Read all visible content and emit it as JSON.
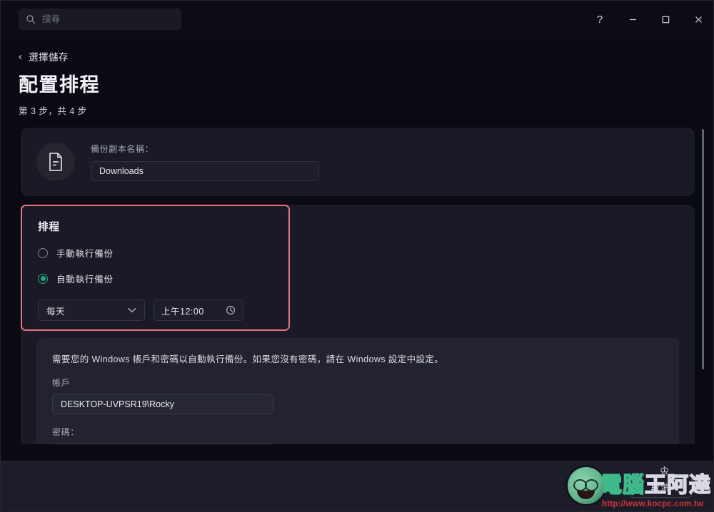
{
  "titlebar": {
    "search_placeholder": "搜尋",
    "search_value": "",
    "help_label": "?",
    "minimize_label": "–",
    "maximize_label": "□",
    "close_label": "✕"
  },
  "header": {
    "back_chevron": "‹",
    "back_label": "選擇儲存",
    "title": "配置排程",
    "step": "第 3 步，共 4 步"
  },
  "name_card": {
    "icon": "document-icon",
    "label": "備份副本名稱：",
    "value": "Downloads",
    "placeholder": "備份副本名稱"
  },
  "schedule": {
    "title": "排程",
    "options": [
      {
        "label": "手動執行備份",
        "selected": false
      },
      {
        "label": "自動執行備份",
        "selected": true
      }
    ],
    "frequency": {
      "value": "每天",
      "chevron_icon": "chevron-down-icon"
    },
    "time": {
      "value": "上午12:00",
      "clock_icon": "clock-icon"
    },
    "highlight_color": "#e4737c",
    "accent_color": "#1fa87a"
  },
  "account": {
    "note": "需要您的 Windows 帳戶和密碼以自動執行備份。如果您沒有密碼，請在 Windows 設定中設定。",
    "account_label": "帳戶",
    "account_value": "DESKTOP-UVPSR19\\Rocky",
    "account_placeholder": "帳戶",
    "password_label": "密碼：",
    "password_value": "",
    "password_placeholder": "密碼"
  },
  "footer": {
    "cancel_label": "取消"
  },
  "watermark": {
    "char1": "電",
    "char2": "腦",
    "char3": "王",
    "char4": "阿",
    "char5": "達",
    "crown": "♔",
    "url": "http://www.kocpc.com.tw"
  }
}
